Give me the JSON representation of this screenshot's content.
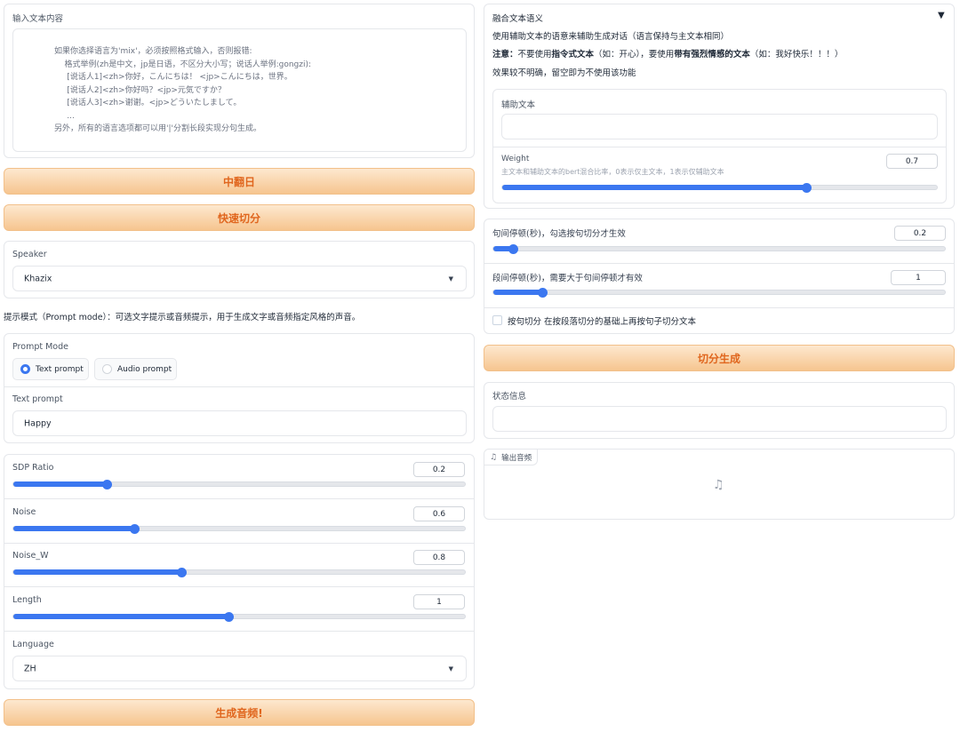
{
  "input_panel": {
    "label": "输入文本内容",
    "placeholder_lines": [
      "如果你选择语言为'mix'，必须按照格式输入，否则报错:",
      "    格式举例(zh是中文，jp是日语，不区分大小写；说话人举例:gongzi):",
      "     [说话人1]<zh>你好，こんにちは！ <jp>こんにちは，世界。",
      "     [说话人2]<zh>你好吗？<jp>元気ですか？",
      "     [说话人3]<zh>谢谢。<jp>どういたしまして。",
      "     ...",
      "另外，所有的语言选项都可以用'|'分割长段实现分句生成。"
    ]
  },
  "buttons": {
    "translate": "中翻日",
    "quick_split": "快速切分",
    "generate_audio": "生成音频!",
    "split_generate": "切分生成"
  },
  "speaker": {
    "label": "Speaker",
    "value": "Khazix"
  },
  "prompt_mode_desc": "提示模式（Prompt mode）：可选文字提示或音频提示，用于生成文字或音频指定风格的声音。",
  "prompt_mode": {
    "label": "Prompt Mode",
    "options": [
      "Text prompt",
      "Audio prompt"
    ],
    "selected": "Text prompt"
  },
  "text_prompt": {
    "label": "Text prompt",
    "value": "Happy"
  },
  "sliders": {
    "sdp_ratio": {
      "label": "SDP Ratio",
      "value": "0.2",
      "fraction": 0.207
    },
    "noise": {
      "label": "Noise",
      "value": "0.6",
      "fraction": 0.268
    },
    "noise_w": {
      "label": "Noise_W",
      "value": "0.8",
      "fraction": 0.372
    },
    "length": {
      "label": "Length",
      "value": "1",
      "fraction": 0.476
    }
  },
  "language": {
    "label": "Language",
    "value": "ZH"
  },
  "fusion": {
    "title": "融合文本语义",
    "collapse_icon": "▼",
    "desc": "使用辅助文本的语意来辅助生成对话（语言保持与主文本相同）",
    "note_prefix": "注意：",
    "note_a": "不要使用",
    "note_b": "指令式文本",
    "note_c": "（如：开心），要使用",
    "note_d": "带有强烈情感的文本",
    "note_e": "（如：我好快乐！！！）",
    "hint": "效果较不明确，留空即为不使用该功能",
    "aux_label": "辅助文本",
    "weight_label": "Weight",
    "weight_hint": "主文本和辅助文本的bert混合比率，0表示仅主文本，1表示仅辅助文本",
    "weight_value": "0.7",
    "weight_fraction": 0.7
  },
  "pause": {
    "sentence_label": "句间停顿(秒)，勾选按句切分才生效",
    "sentence_value": "0.2",
    "sentence_fraction": 0.044,
    "paragraph_label": "段间停顿(秒)，需要大于句间停顿才有效",
    "paragraph_value": "1",
    "paragraph_fraction": 0.108,
    "checkbox_label": "按句切分 在按段落切分的基础上再按句子切分文本"
  },
  "status": {
    "label": "状态信息",
    "value": ""
  },
  "output_audio": {
    "label": "输出音频",
    "icon": "music-note-icon"
  },
  "colors": {
    "accent": "#3b77f0",
    "button_text": "#e0661e",
    "button_bg_top": "#fde8cf",
    "button_bg_bottom": "#f6c58f"
  }
}
